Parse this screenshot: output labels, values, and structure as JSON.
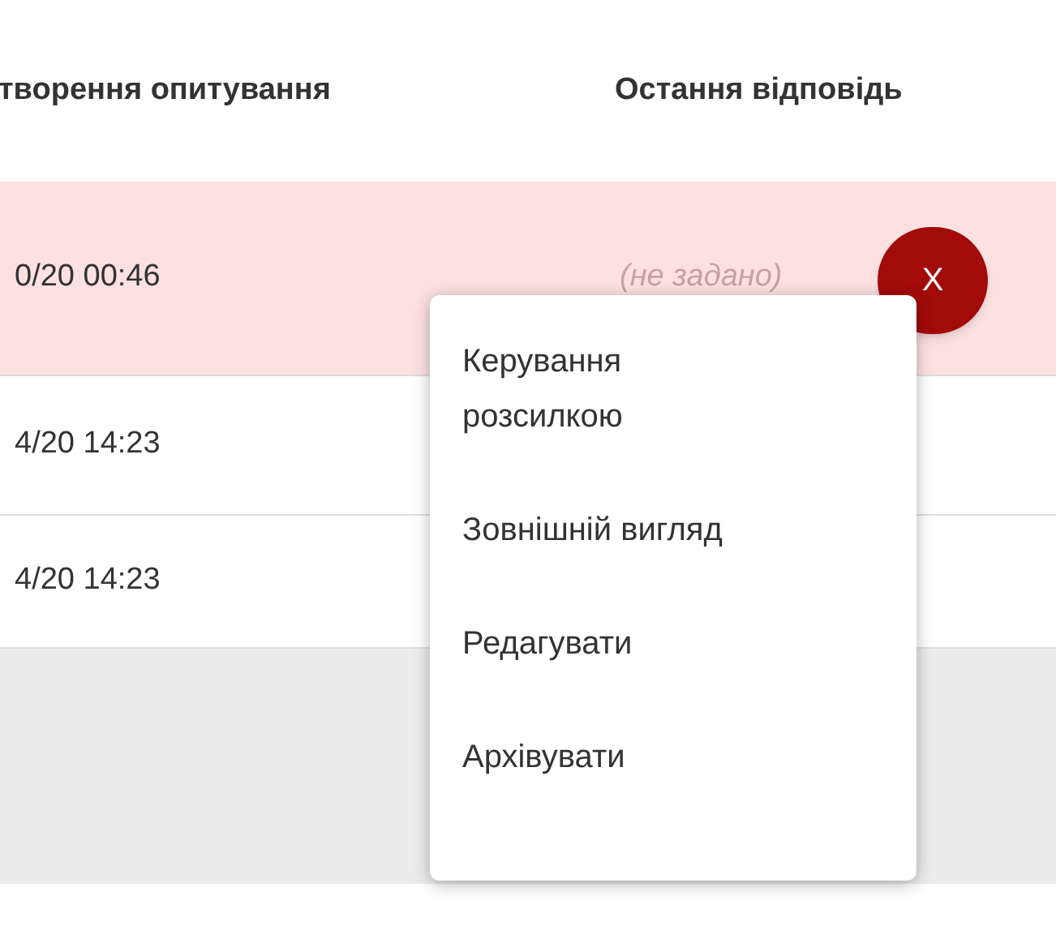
{
  "table": {
    "columns": [
      "творення опитування",
      "Остання відповідь"
    ],
    "rows": [
      {
        "created": "0/20 00:46",
        "last_response": "(не задано)",
        "selected": true
      },
      {
        "created": "4/20 14:23",
        "selected": false
      },
      {
        "created": "4/20 14:23",
        "selected": false
      }
    ]
  },
  "close_button": {
    "label": "X"
  },
  "menu": {
    "items": [
      "Керування розсилкою",
      "Зовнішній вигляд",
      "Редагувати",
      "Архівувати"
    ]
  }
}
